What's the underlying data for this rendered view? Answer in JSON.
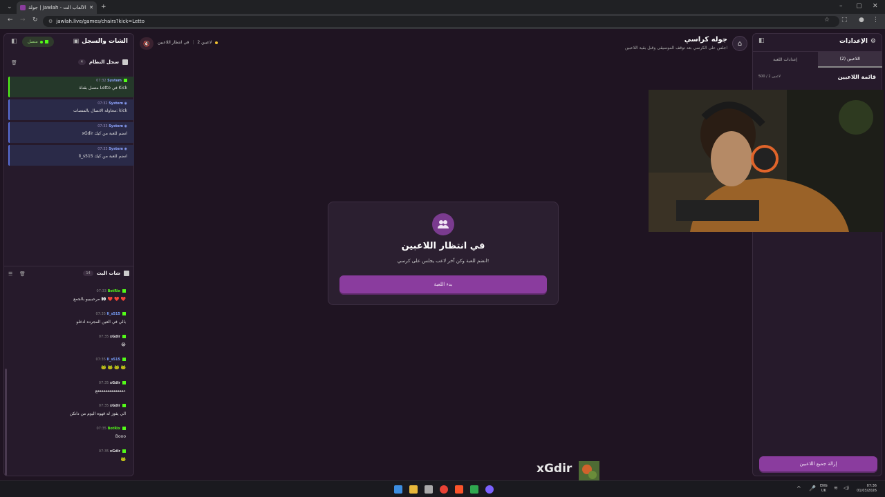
{
  "browser": {
    "tab_title": "جولة | Jawlah - منصة الألعاب الت",
    "url": "jawlah.live/games/chairs?kick=Letto"
  },
  "left_panel": {
    "title": "الشات والسجل",
    "connection_status": "متصل",
    "system_log": {
      "title": "سجل النظام",
      "count": "4"
    },
    "system_messages": [
      {
        "sender": "System",
        "time": "07:32",
        "text": "متصل بقناة Letto في Kick"
      },
      {
        "sender": "System",
        "time": "07:32",
        "text": "محاولة الاتصال بالمنصات: kick"
      },
      {
        "sender": "System",
        "time": "07:33",
        "text": "xGdir انضم للعبة من كيك"
      },
      {
        "sender": "System",
        "time": "07:33",
        "text": "lI_s515 انضم للعبة من كيك"
      }
    ],
    "live_chat": {
      "title": "شات البث",
      "count": "14"
    },
    "chat_messages": [
      {
        "user": "BotRix",
        "time": "07:33",
        "text": "مرحبيبيو بالجمع 👀 ❤️ ❤️ ❤️",
        "color": "#53fc18"
      },
      {
        "user": "lI_s515",
        "time": "07:35",
        "text": "بالي في العين المجرده ادخلو",
        "color": "#7aa2ff"
      },
      {
        "user": "xGdir",
        "time": "07:35",
        "text": "😭",
        "color": "#e0e0e0"
      },
      {
        "user": "lI_s515",
        "time": "07:35",
        "text": "🐸 🐸 🐸 🐸",
        "color": "#7aa2ff"
      },
      {
        "user": "xGdir",
        "time": "07:35",
        "text": "ععععععععععععععع",
        "color": "#e0e0e0"
      },
      {
        "user": "xGdir",
        "time": "07:35",
        "text": "الي يفوز له قهوه اليوم من دانكن",
        "color": "#e0e0e0"
      },
      {
        "user": "BotRix",
        "time": "07:35",
        "text": "Booo",
        "color": "#53fc18"
      },
      {
        "user": "xGdir",
        "time": "07:35",
        "text": "🐸",
        "color": "#e0e0e0"
      }
    ]
  },
  "header": {
    "game_title": "جوله كراسي",
    "game_subtitle": "اجلس على الكرسي بعد توقف الموسيقى وقبل بقية اللاعبين",
    "status": "في انتظار اللاعبين",
    "players_count": "2 لاعبين"
  },
  "waiting_card": {
    "title": "في انتظار اللاعبين",
    "subtitle": "انضم للعبة وكن آخر لاعب يجلس على كرسي!",
    "start_button": "بدء اللعبة"
  },
  "right_panel": {
    "title": "الإعدادات",
    "tabs": [
      "اللاعبين (2)",
      "إعدادات اللعبة"
    ],
    "players_list_title": "قائمة اللاعبين",
    "players_ratio": "500 / 2 لاعبين",
    "remove_all_button": "إزالة جميع اللاعبين"
  },
  "overlay": {
    "streamer_name": "xGdir"
  },
  "taskbar": {
    "lang": "ENG",
    "region": "UK",
    "time": "07:36",
    "date": "01/03/2026"
  },
  "colors": {
    "accent": "#8a3c9e",
    "kick_green": "#53fc18",
    "panel": "#261a2b"
  }
}
